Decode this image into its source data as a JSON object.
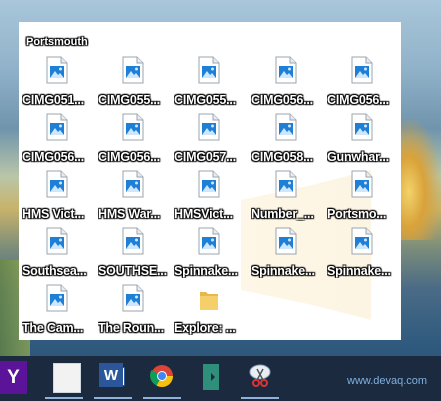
{
  "desktop": {
    "folder": {
      "title": "Portsmouth",
      "files": [
        {
          "label": "CIMG051...",
          "icon": "image-file-icon"
        },
        {
          "label": "CIMG055...",
          "icon": "image-file-icon"
        },
        {
          "label": "CIMG055...",
          "icon": "image-file-icon"
        },
        {
          "label": "CIMG056...",
          "icon": "image-file-icon"
        },
        {
          "label": "CIMG056...",
          "icon": "image-file-icon"
        },
        {
          "label": "CIMG056...",
          "icon": "image-file-icon"
        },
        {
          "label": "CIMG056...",
          "icon": "image-file-icon"
        },
        {
          "label": "CIMG057...",
          "icon": "image-file-icon"
        },
        {
          "label": "CIMG058...",
          "icon": "image-file-icon"
        },
        {
          "label": "Gunwhar...",
          "icon": "image-file-icon"
        },
        {
          "label": "HMS Vict...",
          "icon": "image-file-icon"
        },
        {
          "label": "HMS War...",
          "icon": "image-file-icon"
        },
        {
          "label": "HMSVict...",
          "icon": "image-file-icon"
        },
        {
          "label": "Number_...",
          "icon": "image-file-icon"
        },
        {
          "label": "Portsmo...",
          "icon": "image-file-icon"
        },
        {
          "label": "Southsea...",
          "icon": "image-file-icon"
        },
        {
          "label": "SOUTHSE...",
          "icon": "image-file-icon"
        },
        {
          "label": "Spinnake...",
          "icon": "image-file-icon"
        },
        {
          "label": "Spinnake...",
          "icon": "image-file-icon"
        },
        {
          "label": "Spinnake...",
          "icon": "image-file-icon"
        },
        {
          "label": "The Cam...",
          "icon": "image-file-icon"
        },
        {
          "label": "The Roun...",
          "icon": "image-file-icon"
        },
        {
          "label": "Explore: ...",
          "icon": "folder-icon"
        }
      ]
    }
  },
  "taskbar": {
    "yahoo_label": "Y",
    "word_label": "W",
    "items": [
      "yahoo-icon",
      "blank-app-icon",
      "word-icon",
      "chrome-icon",
      "bookmark-app-icon",
      "snipping-tool-icon"
    ]
  },
  "watermark": "www.devaq.com",
  "colors": {
    "taskbar": "#1b2a3e",
    "yahoo": "#5b139a",
    "word": "#2b579a",
    "icon_blue": "#1e7fd6"
  }
}
